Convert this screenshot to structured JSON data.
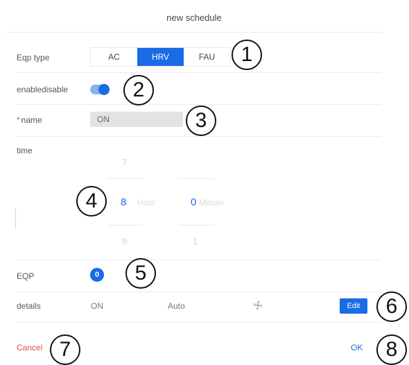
{
  "dialog": {
    "title": "new schedule",
    "eqp_type": {
      "label": "Eqp type",
      "options": [
        "AC",
        "HRV",
        "FAU"
      ],
      "selected": "HRV"
    },
    "enable": {
      "label": "enabledisable",
      "on": true
    },
    "name": {
      "required_mark": "*",
      "label": "name",
      "value": "ON"
    },
    "time": {
      "label": "time",
      "hour": {
        "prev": "7",
        "current": "8",
        "next": "9",
        "unit": "Hour"
      },
      "minute": {
        "prev": "",
        "current": "0",
        "next": "1",
        "unit": "Minute"
      }
    },
    "eqp": {
      "label": "EQP",
      "count": "0"
    },
    "details": {
      "label": "details",
      "mode": "ON",
      "fan": "Auto",
      "icon": "fan-icon",
      "edit_label": "Edit"
    },
    "footer": {
      "cancel_label": "Cancel",
      "ok_label": "OK"
    }
  },
  "markers": [
    "1",
    "2",
    "3",
    "4",
    "5",
    "6",
    "7",
    "8"
  ],
  "colors": {
    "accent": "#1a6be6",
    "danger": "#e24a4a",
    "divider": "#ececec"
  }
}
